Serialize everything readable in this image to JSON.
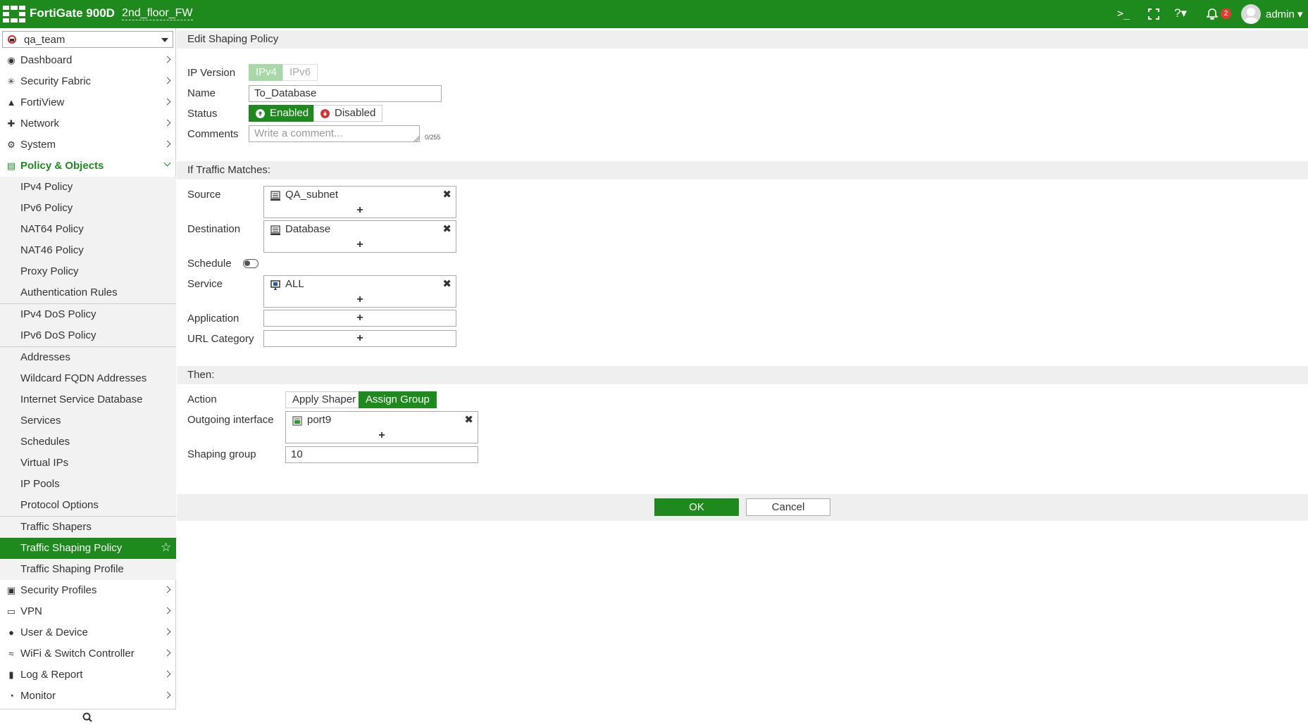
{
  "topbar": {
    "product": "FortiGate 900D",
    "hostname": "2nd_floor_FW",
    "notification_count": "2",
    "user": "admin",
    "icons": [
      "cli-icon",
      "fullscreen-icon",
      "help-icon",
      "bell-icon",
      "avatar"
    ]
  },
  "sidebar": {
    "vdom": "qa_team",
    "items": [
      {
        "label": "Dashboard",
        "icon": "dashboard-icon"
      },
      {
        "label": "Security Fabric",
        "icon": "security-fabric-icon"
      },
      {
        "label": "FortiView",
        "icon": "fortiview-icon"
      },
      {
        "label": "Network",
        "icon": "network-icon"
      },
      {
        "label": "System",
        "icon": "gear-icon"
      },
      {
        "label": "Policy & Objects",
        "icon": "policy-icon"
      }
    ],
    "policy_sub": [
      "IPv4 Policy",
      "IPv6 Policy",
      "NAT64 Policy",
      "NAT46 Policy",
      "Proxy Policy",
      "Authentication Rules",
      "IPv4 DoS Policy",
      "IPv6 DoS Policy",
      "Addresses",
      "Wildcard FQDN Addresses",
      "Internet Service Database",
      "Services",
      "Schedules",
      "Virtual IPs",
      "IP Pools",
      "Protocol Options",
      "Traffic Shapers",
      "Traffic Shaping Policy",
      "Traffic Shaping Profile"
    ],
    "active_sub": "Traffic Shaping Policy",
    "bottom_items": [
      {
        "label": "Security Profiles",
        "icon": "lock-icon"
      },
      {
        "label": "VPN",
        "icon": "vpn-icon"
      },
      {
        "label": "User & Device",
        "icon": "user-icon"
      },
      {
        "label": "WiFi & Switch Controller",
        "icon": "wifi-icon"
      },
      {
        "label": "Log & Report",
        "icon": "log-icon"
      },
      {
        "label": "Monitor",
        "icon": "monitor-icon"
      }
    ]
  },
  "form": {
    "title": "Edit Shaping Policy",
    "ip_version": {
      "label": "IP Version",
      "options": [
        "IPv4",
        "IPv6"
      ],
      "selected": "IPv4"
    },
    "name": {
      "label": "Name",
      "value": "To_Database"
    },
    "status": {
      "label": "Status",
      "enabled": "Enabled",
      "disabled": "Disabled",
      "selected": "Enabled"
    },
    "comments": {
      "label": "Comments",
      "placeholder": "Write a comment...",
      "counter": "0/255"
    },
    "match_section": "If Traffic Matches:",
    "source": {
      "label": "Source",
      "entries": [
        "QA_subnet"
      ]
    },
    "destination": {
      "label": "Destination",
      "entries": [
        "Database"
      ]
    },
    "schedule": {
      "label": "Schedule",
      "enabled": false
    },
    "service": {
      "label": "Service",
      "entries": [
        "ALL"
      ]
    },
    "application": {
      "label": "Application"
    },
    "url_category": {
      "label": "URL Category"
    },
    "then_section": "Then:",
    "action": {
      "label": "Action",
      "options": [
        "Apply Shaper",
        "Assign Group"
      ],
      "selected": "Assign Group"
    },
    "outgoing_interface": {
      "label": "Outgoing interface",
      "entries": [
        "port9"
      ]
    },
    "shaping_group": {
      "label": "Shaping group",
      "value": "10"
    },
    "plus": "+",
    "remove": "✖",
    "ok": "OK",
    "cancel": "Cancel"
  },
  "colors": {
    "brand": "#1e8a1e",
    "brand_light": "#a8d7a8",
    "disabled_red": "#d32f2f"
  }
}
